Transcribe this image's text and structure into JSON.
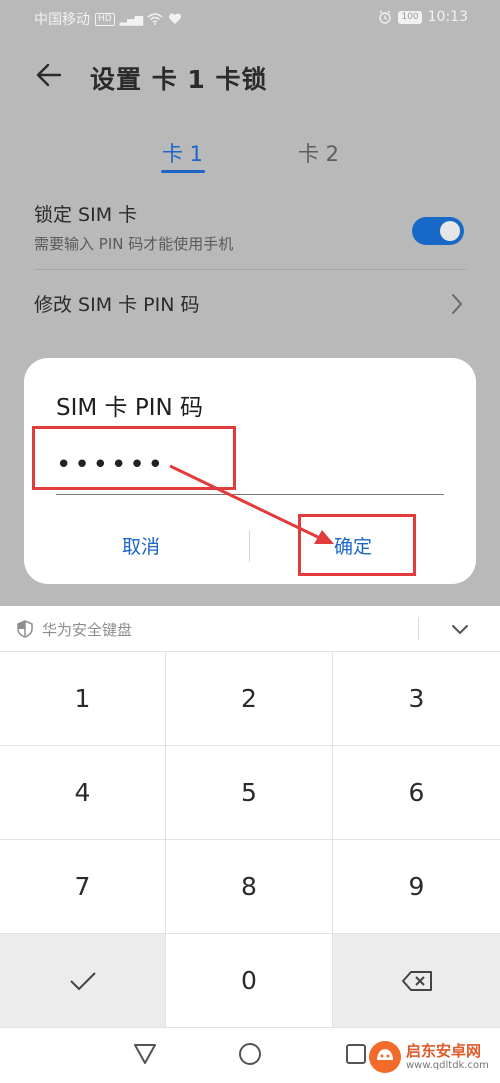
{
  "status_bar": {
    "carrier": "中国移动",
    "hd": "HD",
    "signal": "⁴⁶ᵢₗₗ",
    "battery": "100",
    "time": "10:13"
  },
  "header": {
    "title": "设置 卡 1 卡锁"
  },
  "tabs": [
    {
      "label": "卡 1",
      "active": true
    },
    {
      "label": "卡 2",
      "active": false
    }
  ],
  "lock_row": {
    "title": "锁定 SIM 卡",
    "subtitle": "需要输入 PIN 码才能使用手机",
    "enabled": true
  },
  "pin_row": {
    "title": "修改 SIM 卡 PIN 码"
  },
  "dialog": {
    "title": "SIM 卡 PIN 码",
    "pin_value": "••••••",
    "cancel_label": "取消",
    "ok_label": "确定"
  },
  "keyboard": {
    "title": "华为安全键盘",
    "keys": [
      "1",
      "2",
      "3",
      "4",
      "5",
      "6",
      "7",
      "8",
      "9",
      "✓",
      "0",
      "⌫"
    ]
  },
  "watermark": {
    "name": "启东安卓网",
    "url": "www.qdltdk.com"
  },
  "colors": {
    "accent": "#1b66c9",
    "annotation": "#e23b3b",
    "dim_background": "#b9b9b9"
  }
}
